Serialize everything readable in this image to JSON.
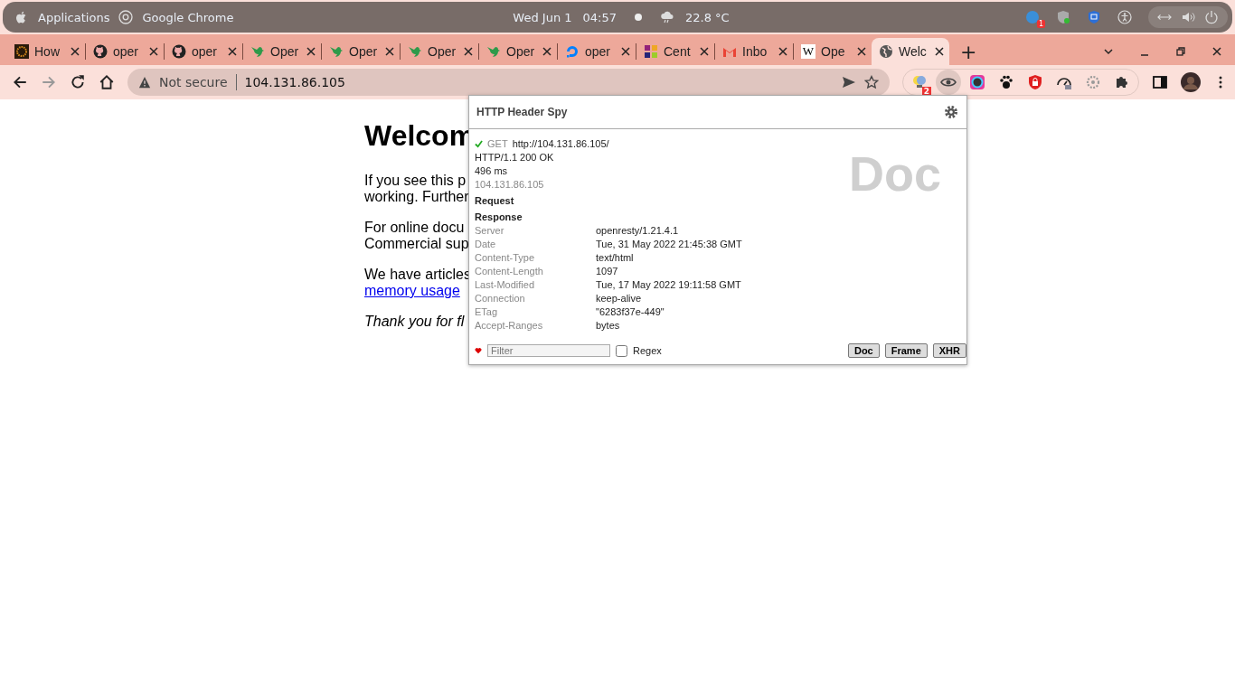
{
  "top_bar": {
    "activities": "Applications",
    "app": "Google Chrome",
    "date": "Wed Jun 1",
    "time": "04:57",
    "weather": "22.8 °C",
    "notification_count": "1"
  },
  "tabs": [
    {
      "title": "How",
      "kind": "image",
      "selected": false
    },
    {
      "title": "oper",
      "kind": "github",
      "selected": false
    },
    {
      "title": "oper",
      "kind": "github",
      "selected": false
    },
    {
      "title": "Oper",
      "kind": "bird",
      "selected": false
    },
    {
      "title": "Oper",
      "kind": "bird",
      "selected": false
    },
    {
      "title": "Oper",
      "kind": "bird",
      "selected": false
    },
    {
      "title": "Oper",
      "kind": "bird",
      "selected": false
    },
    {
      "title": "oper",
      "kind": "cloud",
      "selected": false
    },
    {
      "title": "Cent",
      "kind": "pinwheel",
      "selected": false
    },
    {
      "title": "Inbo",
      "kind": "mail",
      "selected": false
    },
    {
      "title": "Ope",
      "kind": "wiki",
      "icon_text": "W",
      "selected": false
    },
    {
      "title": "Welc",
      "kind": "globe",
      "selected": true
    }
  ],
  "new_tab": "+",
  "address_bar": {
    "security": "Not secure",
    "url": "104.131.86.105"
  },
  "extensions": [
    {
      "kind": "bulb",
      "badge": "2",
      "selected": false
    },
    {
      "kind": "eye",
      "selected": true
    },
    {
      "kind": "ring",
      "selected": false
    },
    {
      "kind": "paw",
      "selected": false
    },
    {
      "kind": "shield",
      "selected": false
    },
    {
      "kind": "gauge",
      "selected": false
    },
    {
      "kind": "sq",
      "selected": false
    },
    {
      "kind": "puzzle",
      "selected": false
    }
  ],
  "page": {
    "heading": "Welcom",
    "paragraphs": [
      [
        "If you see this p",
        "working. Further"
      ],
      [
        "For online docu",
        "Commercial sup"
      ],
      [
        "We have articles"
      ]
    ],
    "link": "memory usage",
    "closing": "Thank you for fl"
  },
  "popup": {
    "title": "HTTP Header Spy",
    "method": "GET",
    "url": "http://104.131.86.105/",
    "status": "HTTP/1.1 200 OK",
    "duration": "496 ms",
    "ip": "104.131.86.105",
    "watermark": "Doc",
    "request_label": "Request",
    "response_label": "Response",
    "headers": [
      {
        "name": "Server",
        "value": "openresty/1.21.4.1"
      },
      {
        "name": "Date",
        "value": "Tue, 31 May 2022 21:45:38 GMT"
      },
      {
        "name": "Content-Type",
        "value": "text/html"
      },
      {
        "name": "Content-Length",
        "value": "1097"
      },
      {
        "name": "Last-Modified",
        "value": "Tue, 17 May 2022 19:11:58 GMT"
      },
      {
        "name": "Connection",
        "value": "keep-alive"
      },
      {
        "name": "ETag",
        "value": "\"6283f37e-449\""
      },
      {
        "name": "Accept-Ranges",
        "value": "bytes"
      }
    ],
    "filter_placeholder": "Filter",
    "regex": {
      "label": "Regex",
      "checked": false
    },
    "buttons": [
      "Doc",
      "Frame",
      "XHR"
    ]
  }
}
